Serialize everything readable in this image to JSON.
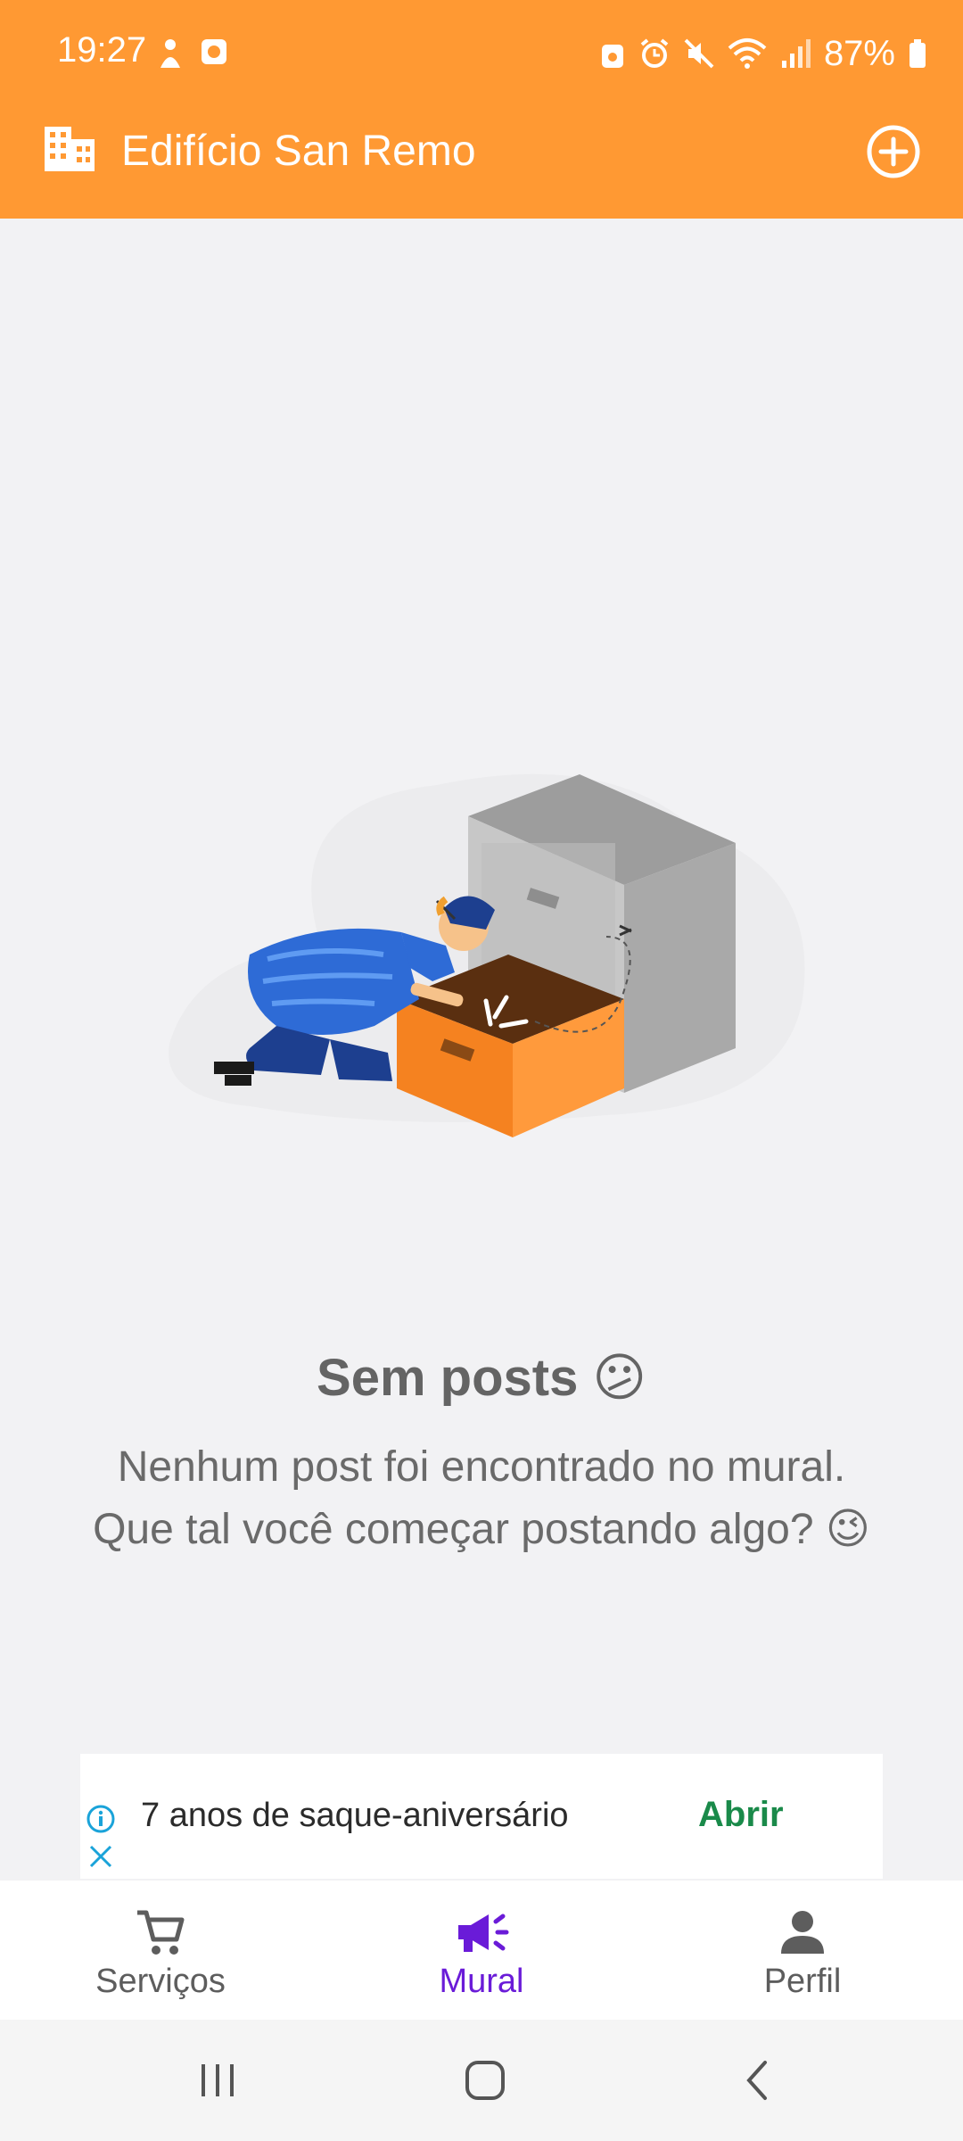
{
  "status_bar": {
    "time": "19:27",
    "battery": "87%"
  },
  "header": {
    "title": "Edifício San Remo",
    "building_icon": "building-icon",
    "add_icon": "add-circle-icon",
    "color": "#ff9933"
  },
  "empty_state": {
    "title": "Sem posts 😕",
    "message_line1": "Nenhum post foi encontrado no mural.",
    "message_line2": "Que tal você começar postando algo? 😉",
    "illustration": "person-searching-drawer-illustration"
  },
  "ad": {
    "text": "7 anos de saque-aniversário",
    "cta": "Abrir",
    "info_icon": "info-icon",
    "close_icon": "close-icon"
  },
  "bottom_nav": {
    "items": [
      {
        "label": "Serviços",
        "icon": "cart-icon",
        "active": false
      },
      {
        "label": "Mural",
        "icon": "megaphone-icon",
        "active": true
      },
      {
        "label": "Perfil",
        "icon": "person-icon",
        "active": false
      }
    ],
    "active_color": "#6a1bd8"
  },
  "system_nav": {
    "recents_icon": "recents-icon",
    "home_icon": "home-icon",
    "back_icon": "back-icon"
  }
}
